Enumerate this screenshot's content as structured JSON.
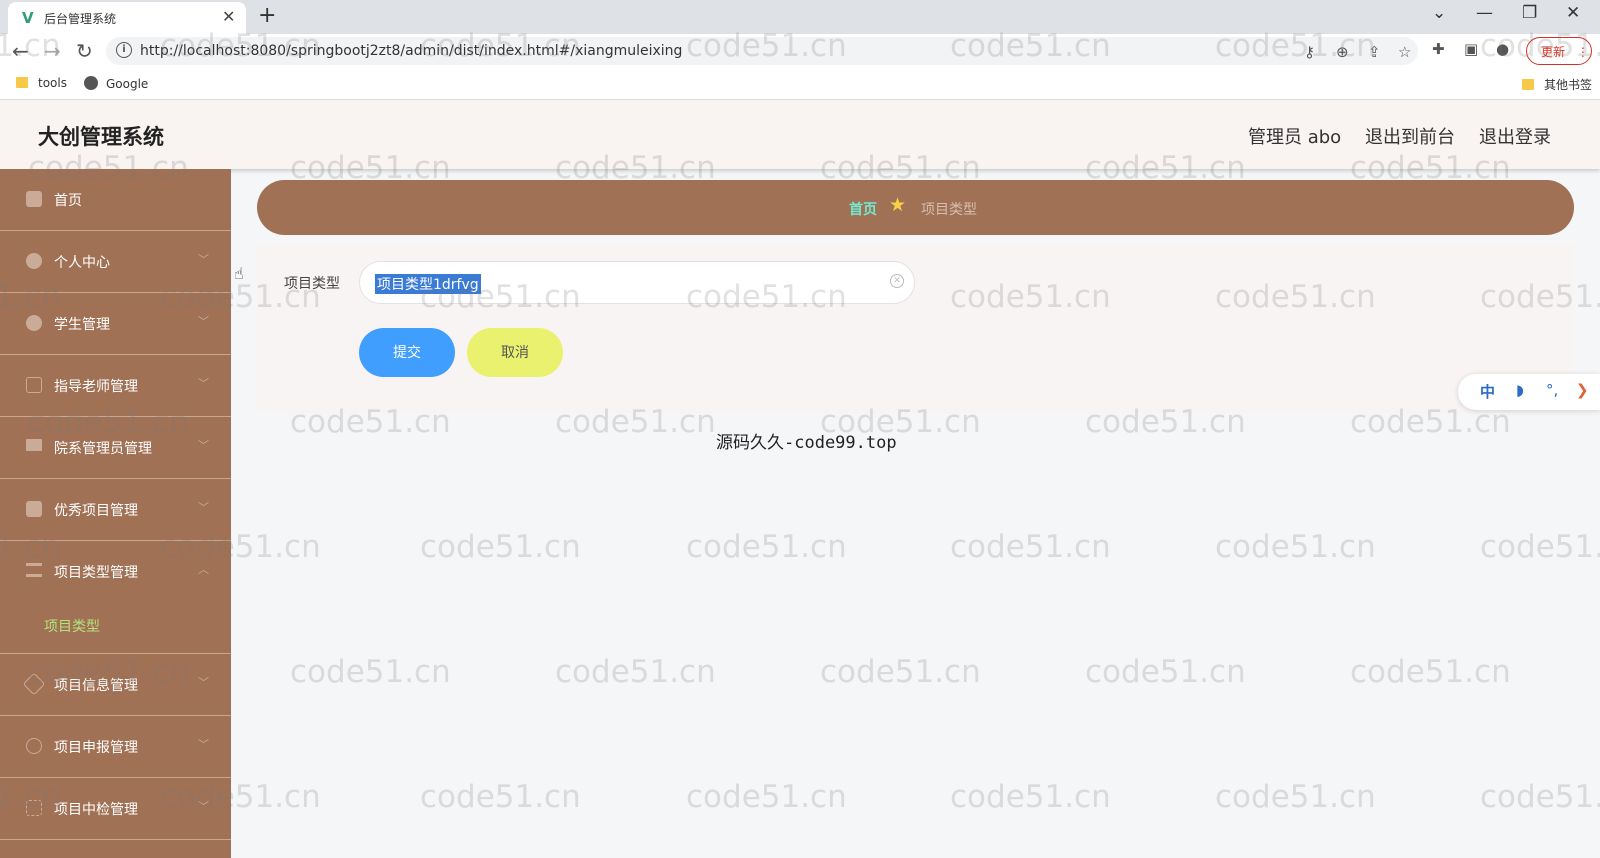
{
  "browser": {
    "tab_title": "后台管理系统",
    "tab_close": "✕",
    "new_tab": "+",
    "url": "http://localhost:8080/springbootj2zt8/admin/dist/index.html#/xiangmuleixing",
    "update_label": "更新",
    "bookmarks": [
      "tools",
      "Google"
    ],
    "other_bookmarks": "其他书签"
  },
  "header": {
    "title": "大创管理系统",
    "user": "管理员 abo",
    "front": "退出到前台",
    "logout": "退出登录"
  },
  "sidebar": {
    "items": [
      {
        "label": "首页",
        "icon": "home-icon"
      },
      {
        "label": "个人中心",
        "icon": "user-icon"
      },
      {
        "label": "学生管理",
        "icon": "user-icon"
      },
      {
        "label": "指导老师管理",
        "icon": "mail-icon"
      },
      {
        "label": "院系管理员管理",
        "icon": "monitor-icon"
      },
      {
        "label": "优秀项目管理",
        "icon": "briefcase-icon"
      },
      {
        "label": "项目类型管理",
        "icon": "list-icon"
      },
      {
        "label": "项目信息管理",
        "icon": "send-icon"
      },
      {
        "label": "项目申报管理",
        "icon": "clock-icon"
      },
      {
        "label": "项目中检管理",
        "icon": "frame-icon"
      }
    ],
    "submenu": {
      "label": "项目类型"
    }
  },
  "breadcrumb": {
    "home": "首页",
    "current": "项目类型"
  },
  "form": {
    "label": "项目类型",
    "value": "项目类型1drfvg",
    "submit": "提交",
    "cancel": "取消"
  },
  "footer": {
    "text": "源码久久-code99.top"
  },
  "float_tool": {
    "lang": "中",
    "moon": "◗",
    "dots": "°,",
    "arrow": "❯"
  },
  "watermark": "code51.cn",
  "colors": {
    "sidebar_bg": "#a07155",
    "accent_green": "#b5e27b",
    "submit_blue": "#409eff",
    "cancel_yellow": "#e9f16e"
  }
}
